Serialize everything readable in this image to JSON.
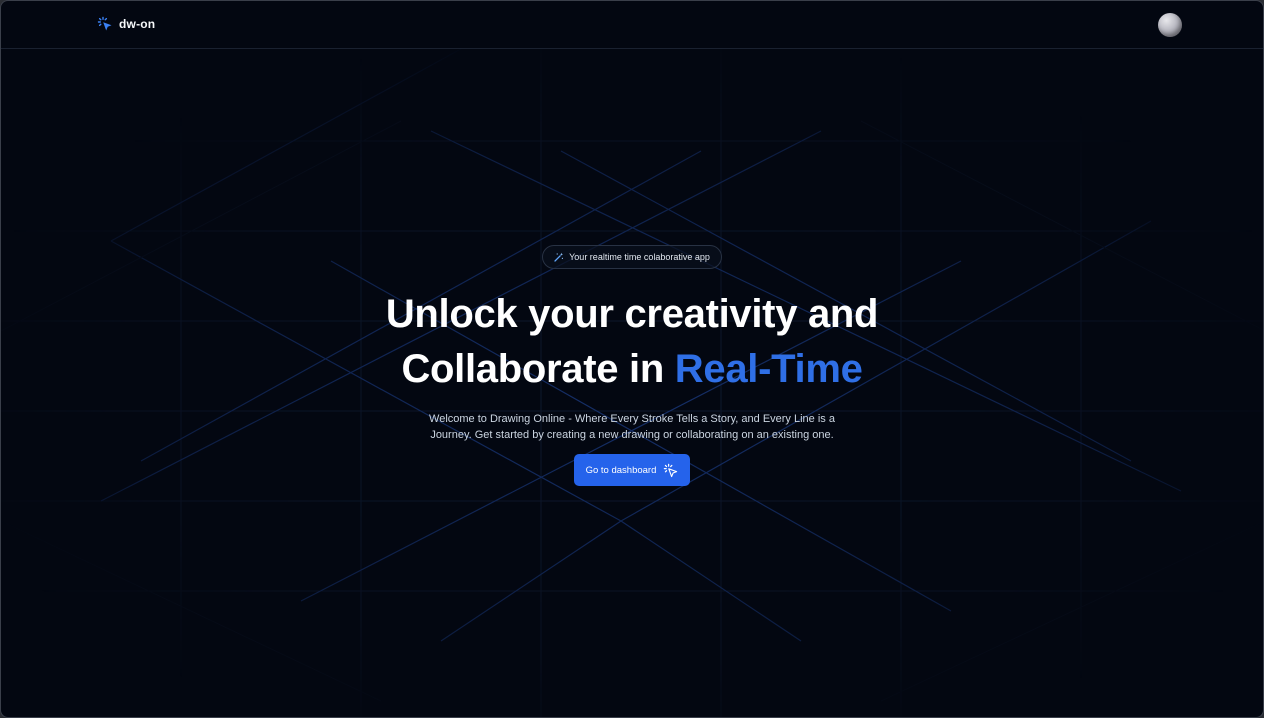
{
  "header": {
    "brand_name": "dw-on",
    "brand_icon": "sparkle-cursor-icon",
    "avatar": "user-avatar"
  },
  "hero": {
    "badge_icon": "magic-wand-icon",
    "badge_text": "Your realtime time colaborative app",
    "headline_line1": "Unlock your creativity and",
    "headline_line2_prefix": "Collaborate in ",
    "headline_line2_accent": "Real-Time",
    "description": "Welcome to Drawing Online - Where Every Stroke Tells a Story, and Every Line is a Journey. Get started by creating a new drawing or collaborating on an existing one.",
    "cta_label": "Go to dashboard",
    "cta_icon": "sparkle-cursor-icon"
  },
  "colors": {
    "background": "#030711",
    "accent": "#2f6fe6",
    "button": "#2563eb",
    "text": "#ffffff"
  }
}
